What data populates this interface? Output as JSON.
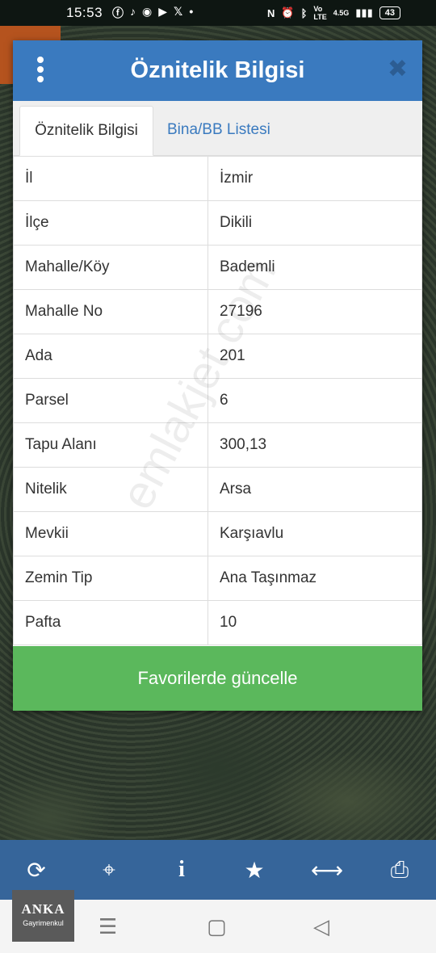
{
  "status_bar": {
    "time": "15:53",
    "left_icons": [
      "facebook-icon",
      "tiktok-icon",
      "spotify-icon",
      "youtube-icon",
      "x-icon",
      "dot-icon"
    ],
    "right_icons": [
      "nfc-icon",
      "alarm-icon",
      "bluetooth-icon",
      "volte-icon",
      "signal-icon"
    ],
    "network": "4.5G",
    "battery": "43"
  },
  "dialog": {
    "title": "Öznitelik Bilgisi",
    "tabs": [
      {
        "label": "Öznitelik Bilgisi",
        "active": true
      },
      {
        "label": "Bina/BB Listesi",
        "active": false
      }
    ],
    "rows": [
      {
        "key": "İl",
        "value": "İzmir"
      },
      {
        "key": "İlçe",
        "value": "Dikili"
      },
      {
        "key": "Mahalle/Köy",
        "value": "Bademli"
      },
      {
        "key": "Mahalle No",
        "value": "27196"
      },
      {
        "key": "Ada",
        "value": "201"
      },
      {
        "key": "Parsel",
        "value": "6"
      },
      {
        "key": "Tapu Alanı",
        "value": "300,13"
      },
      {
        "key": "Nitelik",
        "value": "Arsa"
      },
      {
        "key": "Mevkii",
        "value": "Karşıavlu"
      },
      {
        "key": "Zemin Tip",
        "value": "Ana Taşınmaz"
      },
      {
        "key": "Pafta",
        "value": "10"
      }
    ],
    "button_label": "Favorilerde güncelle",
    "watermark": "emlakjet.com"
  },
  "toolbar": {
    "items": [
      "refresh-icon",
      "crosshair-icon",
      "info-icon",
      "star-icon",
      "measure-icon",
      "print-icon"
    ]
  },
  "logo": {
    "name": "ANKA",
    "sub": "Gayrimenkul"
  },
  "colors": {
    "header": "#3a7abf",
    "button": "#5bb85c",
    "toolbar": "#36659a"
  }
}
